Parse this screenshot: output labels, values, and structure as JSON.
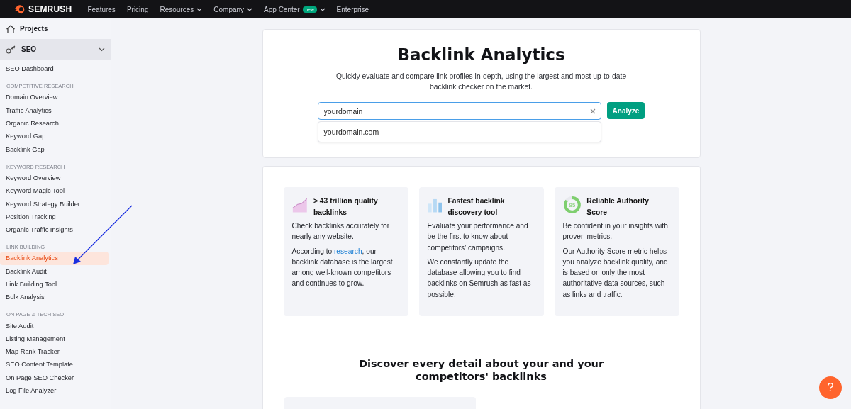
{
  "topbar": {
    "logo": "SEMRUSH",
    "nav": [
      {
        "label": "Features",
        "dropdown": false
      },
      {
        "label": "Pricing",
        "dropdown": false
      },
      {
        "label": "Resources",
        "dropdown": true
      },
      {
        "label": "Company",
        "dropdown": true
      },
      {
        "label": "App Center",
        "dropdown": true,
        "badge": "new"
      },
      {
        "label": "Enterprise",
        "dropdown": false
      }
    ]
  },
  "sidebar": {
    "projects": "Projects",
    "seo": {
      "label": "SEO",
      "expanded": true
    },
    "dashboard": {
      "label": "SEO Dashboard",
      "selected": false
    },
    "sections": [
      {
        "heading": "COMPETITIVE RESEARCH",
        "items": [
          {
            "label": "Domain Overview",
            "selected": false
          },
          {
            "label": "Traffic Analytics",
            "selected": false
          },
          {
            "label": "Organic Research",
            "selected": false
          },
          {
            "label": "Keyword Gap",
            "selected": false
          },
          {
            "label": "Backlink Gap",
            "selected": false
          }
        ]
      },
      {
        "heading": "KEYWORD RESEARCH",
        "items": [
          {
            "label": "Keyword Overview",
            "selected": false
          },
          {
            "label": "Keyword Magic Tool",
            "selected": false
          },
          {
            "label": "Keyword Strategy Builder",
            "selected": false
          },
          {
            "label": "Position Tracking",
            "selected": false
          },
          {
            "label": "Organic Traffic Insights",
            "selected": false
          }
        ]
      },
      {
        "heading": "LINK BUILDING",
        "items": [
          {
            "label": "Backlink Analytics",
            "selected": true
          },
          {
            "label": "Backlink Audit",
            "selected": false
          },
          {
            "label": "Link Building Tool",
            "selected": false
          },
          {
            "label": "Bulk Analysis",
            "selected": false
          }
        ]
      },
      {
        "heading": "ON PAGE & TECH SEO",
        "items": [
          {
            "label": "Site Audit",
            "selected": false
          },
          {
            "label": "Listing Management",
            "selected": false
          },
          {
            "label": "Map Rank Tracker",
            "selected": false
          },
          {
            "label": "SEO Content Template",
            "selected": false
          },
          {
            "label": "On Page SEO Checker",
            "selected": false
          },
          {
            "label": "Log File Analyzer",
            "selected": false
          }
        ]
      }
    ]
  },
  "hero": {
    "title": "Backlink Analytics",
    "subtitle": "Quickly evaluate and compare link profiles in-depth, using the largest and most up-to-date backlink checker on the market.",
    "search": {
      "value": "yourdomain",
      "suggestion": "yourdomain.com"
    },
    "button": "Analyze"
  },
  "features": [
    {
      "kind": "area-chart",
      "title": "> 43 trillion quality backlinks",
      "paragraphs": [
        {
          "text": "Check backlinks accurately for nearly any website."
        },
        {
          "before": "According to ",
          "link": "research",
          "after": ", our backlink database is the largest among well-known competitors and continues to grow."
        }
      ]
    },
    {
      "kind": "bar-chart",
      "title": "Fastest backlink discovery tool",
      "paragraphs": [
        {
          "text": "Evaluate your performance and be the first to know about competitors' campaigns."
        },
        {
          "text": "We constantly update the database allowing you to find backlinks on Semrush as fast as possible."
        }
      ]
    },
    {
      "kind": "score",
      "score": "85",
      "level": 0.85,
      "title": "Reliable Authority Score",
      "paragraphs": [
        {
          "text": "Be confident in your insights with proven metrics."
        },
        {
          "text": "Our Authority Score metric helps you analyze backlink quality, and is based on only the most authoritative data sources, such as links and traffic."
        }
      ]
    }
  ],
  "discover": {
    "title": "Discover every detail about your and your competitors' backlinks"
  },
  "help": {
    "label": "?"
  }
}
